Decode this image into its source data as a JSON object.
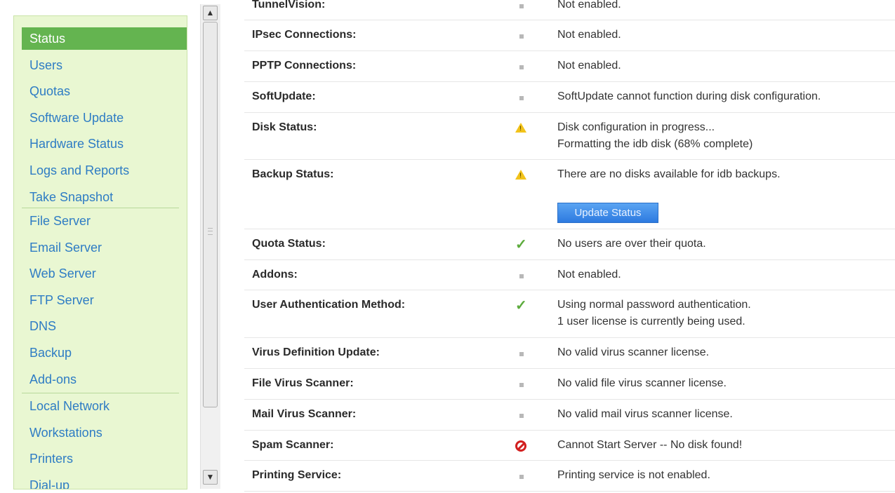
{
  "sidebar": {
    "groups": [
      [
        "Status",
        "Users",
        "Quotas",
        "Software Update",
        "Hardware Status",
        "Logs and Reports",
        "Take Snapshot"
      ],
      [
        "File Server",
        "Email Server",
        "Web Server",
        "FTP Server",
        "DNS",
        "Backup",
        "Add-ons"
      ],
      [
        "Local Network",
        "Workstations",
        "Printers",
        "Dial-up"
      ]
    ],
    "active": "Status"
  },
  "rows": [
    {
      "label": "TunnelVision:",
      "indicator": "dot",
      "lines": [
        "Not enabled."
      ]
    },
    {
      "label": "IPsec Connections:",
      "indicator": "dot",
      "lines": [
        "Not enabled."
      ]
    },
    {
      "label": "PPTP Connections:",
      "indicator": "dot",
      "lines": [
        "Not enabled."
      ]
    },
    {
      "label": "SoftUpdate:",
      "indicator": "dot",
      "lines": [
        "SoftUpdate cannot function during disk configuration."
      ]
    },
    {
      "label": "Disk Status:",
      "indicator": "warning",
      "lines": [
        "Disk configuration in progress...",
        "Formatting the idb disk (68% complete)"
      ]
    },
    {
      "label": "Backup Status:",
      "indicator": "warning",
      "lines": [
        "There are no disks available for idb backups."
      ],
      "button": "Update Status"
    },
    {
      "label": "Quota Status:",
      "indicator": "check",
      "lines": [
        "No users are over their quota."
      ]
    },
    {
      "label": "Addons:",
      "indicator": "dot",
      "lines": [
        "Not enabled."
      ]
    },
    {
      "label": "User Authentication Method:",
      "indicator": "check",
      "lines": [
        "Using normal password authentication.",
        "1 user license is currently being used."
      ]
    },
    {
      "label": "Virus Definition Update:",
      "indicator": "dot",
      "lines": [
        "No valid virus scanner license."
      ]
    },
    {
      "label": "File Virus Scanner:",
      "indicator": "dot",
      "lines": [
        "No valid file virus scanner license."
      ]
    },
    {
      "label": "Mail Virus Scanner:",
      "indicator": "dot",
      "lines": [
        "No valid mail virus scanner license."
      ]
    },
    {
      "label": "Spam Scanner:",
      "indicator": "error",
      "lines": [
        "Cannot Start Server -- No disk found!"
      ]
    },
    {
      "label": "Printing Service:",
      "indicator": "dot",
      "lines": [
        "Printing service is not enabled."
      ]
    }
  ],
  "colors": {
    "accent": "#64b450",
    "link": "#2e7cc4",
    "warning": "#f2c31a",
    "ok": "#5cab3c",
    "error": "#d21f1f"
  }
}
